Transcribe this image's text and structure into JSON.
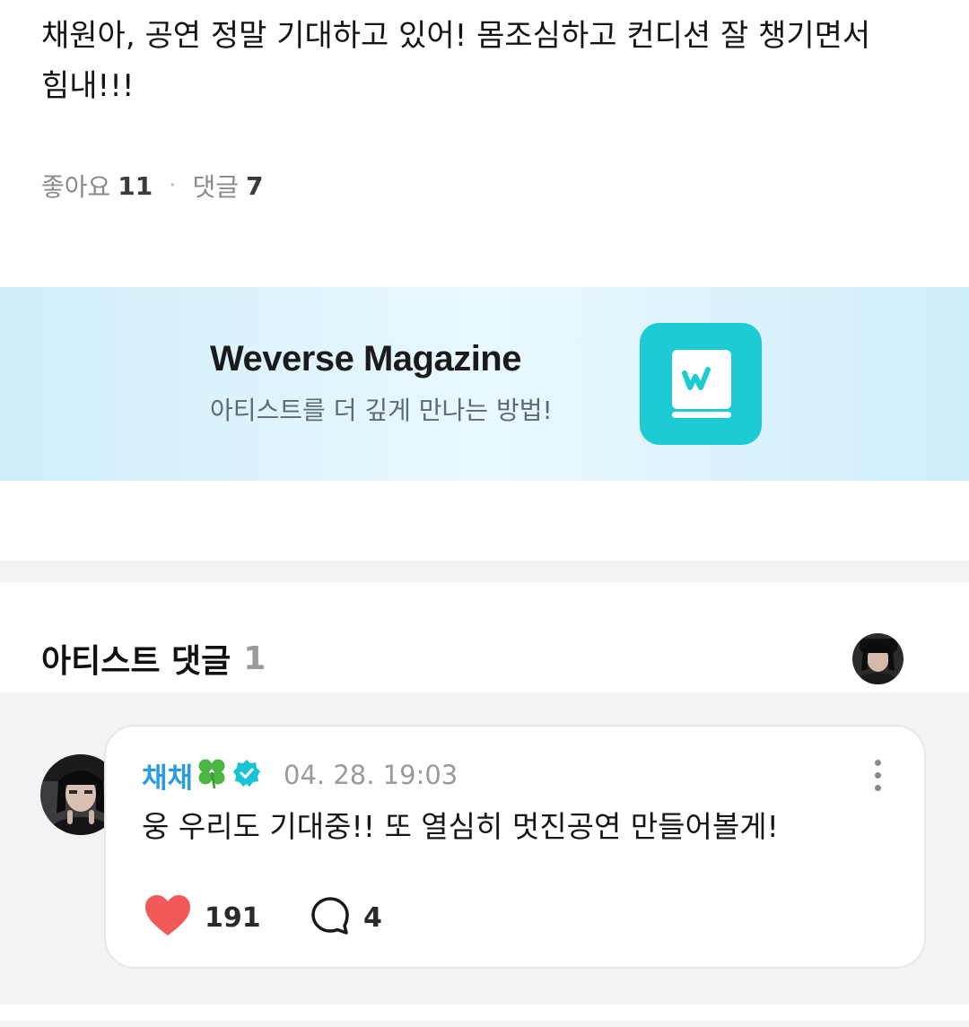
{
  "post": {
    "text": "채원아, 공연 정말 기대하고 있어! 몸조심하고 컨디션 잘 챙기면서 힘내!!!",
    "likes_label": "좋아요",
    "likes_count": "11",
    "separator": "·",
    "comments_label": "댓글",
    "comments_count": "7"
  },
  "banner": {
    "title": "Weverse Magazine",
    "subtitle": "아티스트를 더 깊게 만나는 방법!",
    "logo_icon": "weverse-magazine-book-icon",
    "logo_color": "#1ccbd3"
  },
  "artist_comments": {
    "title": "아티스트 댓글",
    "count": "1",
    "comment": {
      "author": "채채",
      "author_color": "#2b9be6",
      "verified_color": "#16c4d4",
      "time": "04. 28. 19:03",
      "text": "웅 우리도 기대중!! 또 열심히 멋진공연 만들어볼게!",
      "likes": "191",
      "replies": "4",
      "like_icon": "heart-icon",
      "reply_icon": "speech-bubble-icon"
    }
  }
}
